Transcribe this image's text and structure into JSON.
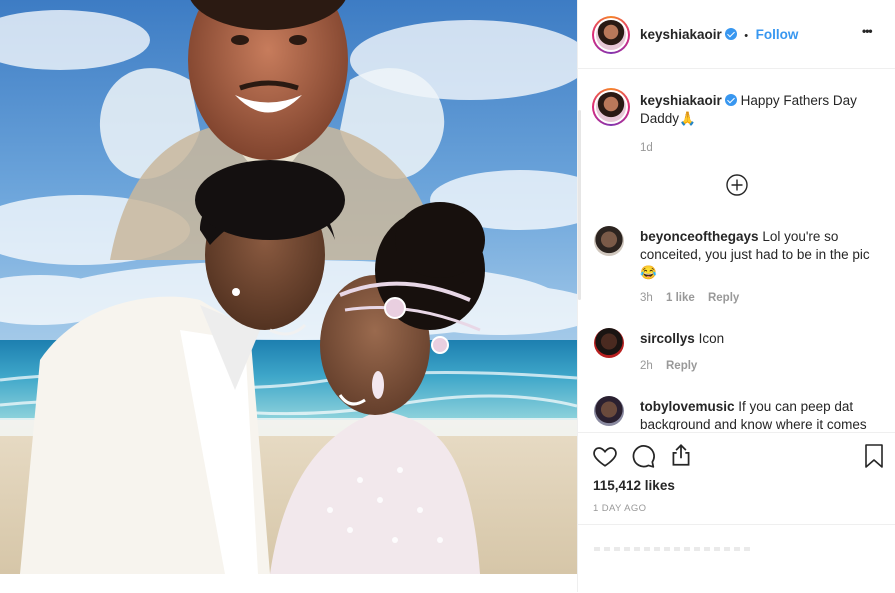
{
  "post": {
    "username": "keyshiakaoir",
    "follow_label": "Follow",
    "separator": "•",
    "more_label": "•••"
  },
  "caption": {
    "username": "keyshiakaoir",
    "text": "Happy Fathers Day Daddy🙏",
    "time": "1d"
  },
  "comments": [
    {
      "username": "beyonceofthegays",
      "text": "Lol you're so conceited, you just had to be in the pic 😂",
      "time": "3h",
      "likes": "1 like",
      "reply": "Reply"
    },
    {
      "username": "sircollys",
      "text": "Icon",
      "time": "2h",
      "reply": "Reply"
    },
    {
      "username": "tobylovemusic",
      "text": "If you can peep dat background and know where it comes"
    }
  ],
  "stats": {
    "likes": "115,412 likes",
    "date": "1 DAY AGO"
  },
  "icons": {
    "add_comments": "plus-circle-icon",
    "like": "heart-icon",
    "comment": "comment-icon",
    "share": "share-icon",
    "save": "bookmark-icon"
  },
  "colors": {
    "link": "#3897f0",
    "verified": "#3897f0",
    "text": "#262626",
    "muted": "#999999"
  }
}
